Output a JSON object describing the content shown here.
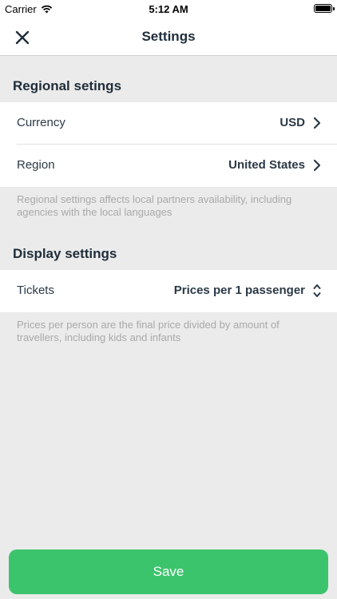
{
  "status_bar": {
    "carrier": "Carrier",
    "time": "5:12 AM"
  },
  "header": {
    "title": "Settings",
    "close_icon": "close-icon"
  },
  "regional": {
    "title": "Regional setings",
    "currency_label": "Currency",
    "currency_value": "USD",
    "region_label": "Region",
    "region_value": "United States",
    "footnote": "Regional settings affects local partners availability, including agencies with the local languages"
  },
  "display": {
    "title": "Display settings",
    "tickets_label": "Tickets",
    "tickets_value": "Prices per 1 passenger",
    "footnote": "Prices per person are the final price divided by amount of travellers, including kids and infants"
  },
  "actions": {
    "save_label": "Save"
  },
  "colors": {
    "accent": "#3cc46d",
    "background": "#ebebeb",
    "text": "#1f2d3a",
    "muted": "#a9a9a9"
  }
}
